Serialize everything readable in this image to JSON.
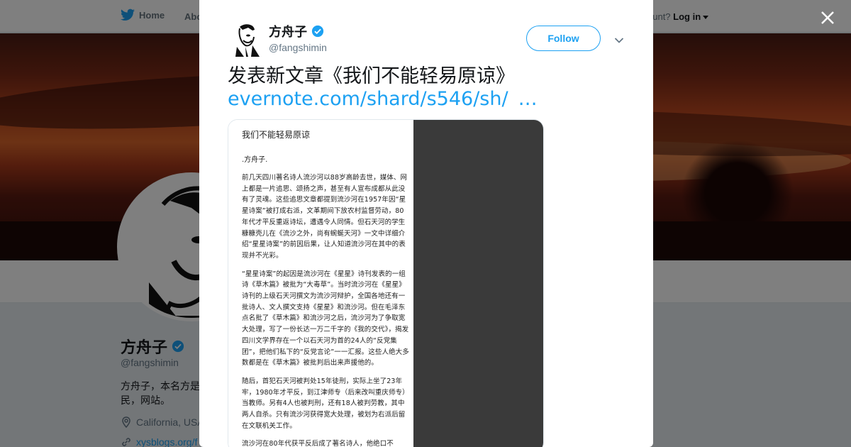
{
  "nav": {
    "home_label": "Home",
    "about_label": "Abo",
    "account_prompt": "ccount?",
    "login_label": "Log in"
  },
  "profile": {
    "name": "方舟子",
    "handle": "@fangshimin",
    "bio": "方舟子，本名方是民，网站。",
    "location": "California, USA",
    "link": "xysblogs.org/f"
  },
  "tweet": {
    "author_name": "方舟子",
    "author_handle": "@fangshimin",
    "follow_label": "Follow",
    "text_prefix": "发表新文章《我们不能轻易原谅》",
    "link_text": "evernote.com/shard/s546/sh/",
    "ellipsis": "…"
  },
  "document": {
    "title": "我们不能轻易原谅",
    "author": ".方舟子.",
    "paragraphs": [
      "前几天四川著名诗人流沙河以88岁高龄去世，媒体、网上都是一片追思、颂扬之声，甚至有人宣布成都从此没有了灵魂。这些追思文章都提到流沙河在1957年因“星星诗案”被打成右派，文革期间下放农村监督劳动，80年代才平反重返诗坛，遭遇令人同情。但石天河的学生糠糠壳儿在《流沙之外，尚有蜿蜒天河》一文中详细介绍“星星诗案”的前因后果，让人知道流沙河在其中的表现并不光彩。",
      "“星星诗案”的起因是流沙河在《星星》诗刊发表的一组诗《草木篇》被批为“大毒草”。当时流沙河在《星星》诗刊的上级石天河撰文为流沙河辩护，全国各地还有一批诗人、文人撰文支持《星星》和流沙河。但在毛泽东点名批了《草木篇》和流沙河之后，流沙河为了争取宽大处理，写了一份长达一万二千字的《我的交代》，揭发四川文学界存在一个以石天河为首的24人的“反党集团”，把他们私下的“反党言论”一一汇报。这些人绝大多数都是在《草木篇》被批判后出来声援他的。",
      "随后，首犯石天河被判处15年徒刑，实际上坐了23年牢，1980年才平反，到江津师专（后来改叫重庆师专）当教师。另有4人也被判刑，还有18人被判劳教，其中两人自杀。只有流沙河获得宽大处理，被划为右派后留在文联机关工作。",
      "流沙河在80年代获平反后成了著名诗人，他绝口不"
    ]
  },
  "colors": {
    "accent": "#1da1f2",
    "text": "#14171a",
    "muted": "#657786"
  }
}
